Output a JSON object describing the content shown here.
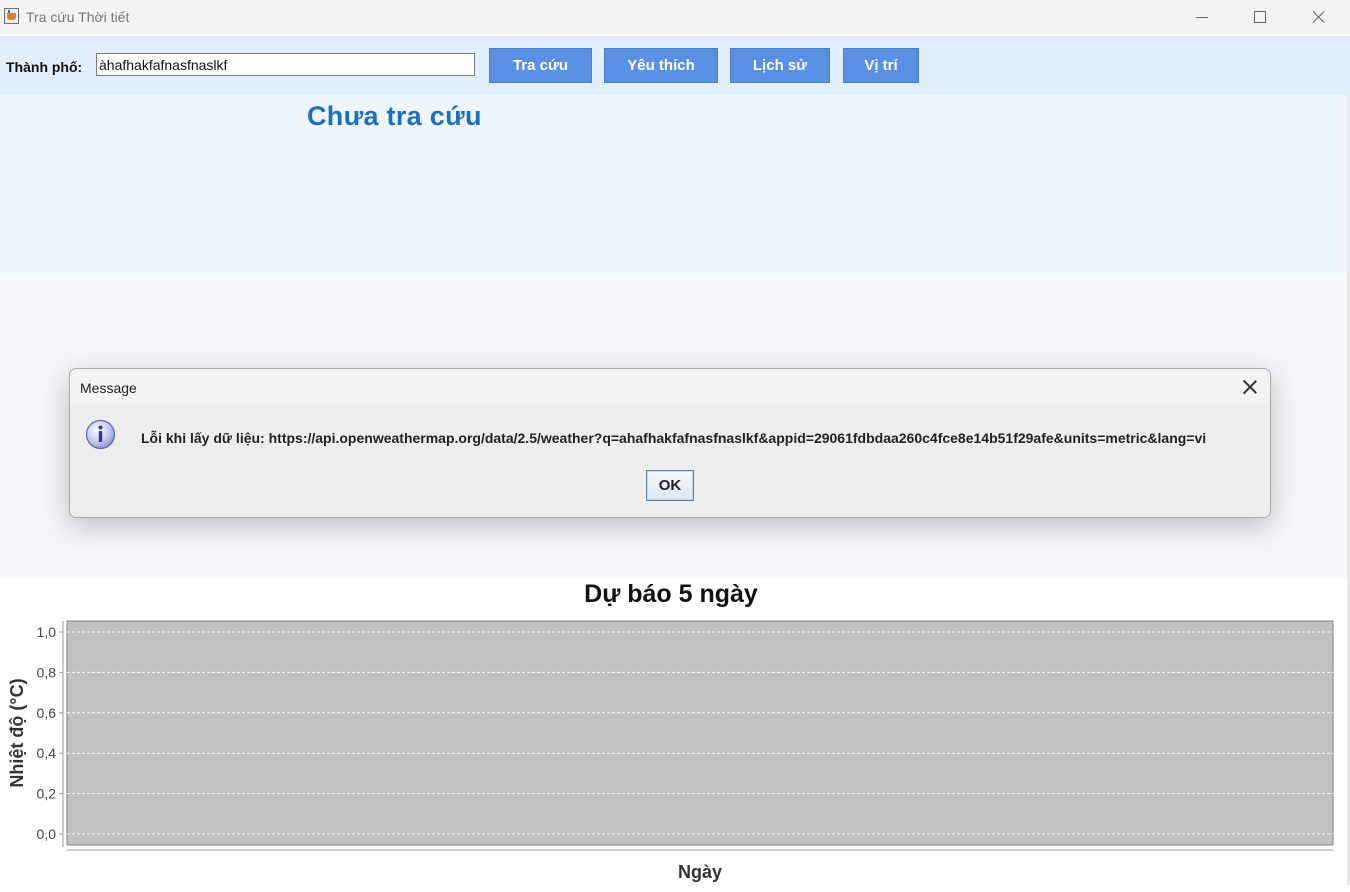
{
  "window": {
    "title": "Tra cứu Thời tiết",
    "controls": {
      "minimize_icon": "minimize-icon",
      "maximize_icon": "maximize-icon",
      "close_icon": "close-icon"
    }
  },
  "toolbar": {
    "city_label": "Thành phố:",
    "city_value": "àhafhakfafnasfnaslkf",
    "buttons": {
      "search": "Tra cứu",
      "favorites": "Yêu thích",
      "history": "Lịch sử",
      "location": "Vị trí"
    },
    "button_color": "#5b8fe3"
  },
  "status": {
    "text": "Chưa tra cứu",
    "color": "#1a6fc0"
  },
  "dialog": {
    "title": "Message",
    "icon": "info-icon",
    "message": "Lỗi khi lấy dữ liệu: https://api.openweathermap.org/data/2.5/weather?q=ahafhakfafnasfnaslkf&appid=29061fdbdaa260c4fce8e14b51f29afe&units=metric&lang=vi",
    "ok_label": "OK"
  },
  "chart_data": {
    "type": "line",
    "title": "Dự báo 5 ngày",
    "xlabel": "Ngày",
    "ylabel": "Nhiệt độ (°C)",
    "ylim": [
      0,
      1
    ],
    "y_ticks": [
      "0,0",
      "0,2",
      "0,4",
      "0,6",
      "0,8",
      "1,0"
    ],
    "categories": [],
    "series": [],
    "grid": true,
    "plot_background": "#c0c0c0"
  }
}
